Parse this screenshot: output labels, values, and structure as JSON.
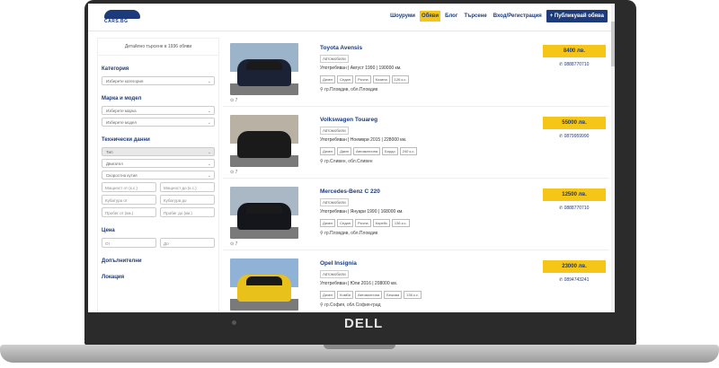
{
  "device": {
    "brand": "DELL"
  },
  "header": {
    "logo_text": "CARS.BG",
    "nav": [
      {
        "label": "Шоуруми",
        "active": false
      },
      {
        "label": "Обяви",
        "active": true
      },
      {
        "label": "Блог",
        "active": false
      },
      {
        "label": "Търсене",
        "active": false
      },
      {
        "label": "Вход/Регистрация",
        "active": false
      }
    ],
    "publish_label": "+ Публикувай обява"
  },
  "sidebar": {
    "heading": "Детайлно търсене в 1936 обяви",
    "category_title": "Категория",
    "category_select": "Изберете категория",
    "make_model_title": "Марка и модел",
    "make_select": "Изберете марка",
    "model_select": "Изберете модел",
    "tech_title": "Технически данни",
    "type_select": "Тип",
    "engine_select": "Двигател",
    "gearbox_select": "Скоростна кутия",
    "power_from": "Мощност от (к.с.)",
    "power_to": "Мощност до (к.с.)",
    "cc_from": "Кубатура от",
    "cc_to": "Кубатура до",
    "mileage_from": "Пробег от (км.)",
    "mileage_to": "Пробег до (км.)",
    "price_title": "Цена",
    "price_from": "От",
    "price_to": "До",
    "extras_title": "Допълнителни",
    "location_title": "Локация"
  },
  "listings": [
    {
      "title": "Toyota Avensis",
      "category": "Автомобили",
      "desc": "Употребяван | Август 1990 | 190000 км.",
      "tags": [
        "Дизел",
        "Седан",
        "Ръчна",
        "Козина",
        "126 к.с."
      ],
      "location": "гр.Пловдив, обл.Пловдив",
      "price": "8400 лв.",
      "phone": "0888770710",
      "photos": "7",
      "car_color": "#1b2236",
      "sky_color": "#9bb4c9"
    },
    {
      "title": "Volkswagen Touareg",
      "category": "Автомобили",
      "desc": "Употребяван | Ноември 2015 | 228000 км.",
      "tags": [
        "Дизел",
        "Джип",
        "Автоматична",
        "Бордо",
        "240 к.с."
      ],
      "location": "гр.Сливен, обл.Сливен",
      "price": "55000 лв.",
      "phone": "0879959990",
      "photos": "7",
      "car_color": "#1a1a1a",
      "sky_color": "#b9b1a4"
    },
    {
      "title": "Mercedes-Benz C 220",
      "category": "Автомобили",
      "desc": "Употребяван | Януари 1990 | 168000 км.",
      "tags": [
        "Дизел",
        "Седан",
        "Ръчна",
        "Корейс",
        "136 к.с."
      ],
      "location": "гр.Пловдив, обл.Пловдив",
      "price": "12500 лв.",
      "phone": "0888770710",
      "photos": "7",
      "car_color": "#14161b",
      "sky_color": "#a9b8c4"
    },
    {
      "title": "Opel Insignia",
      "category": "Автомобили",
      "desc": "Употребяван | Юли 2016 | 208000 км.",
      "tags": [
        "Дизел",
        "Комби",
        "Автоматична",
        "Бежова",
        "136 к.с."
      ],
      "location": "гр.София, обл.София-град",
      "price": "23000 лв.",
      "phone": "0894743241",
      "photos": "",
      "car_color": "#e8c21a",
      "sky_color": "#8fb2d6"
    }
  ]
}
